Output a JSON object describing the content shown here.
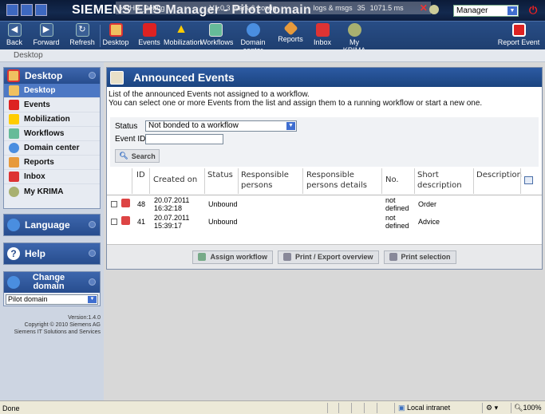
{
  "topbar": {
    "brand": "SIEMENS EHS Manager - Pilot domain",
    "debug_label": "» PHP_Debug",
    "version_tag": "V1.0.3",
    "vars_config": "vars & config",
    "logs_msgs": "logs & msgs",
    "query_count": "35",
    "timing": "1071.5 ms",
    "role_selected": "Manager"
  },
  "toolbar": {
    "back": "Back",
    "forward": "Forward",
    "refresh": "Refresh",
    "desktop": "Desktop",
    "events": "Events",
    "mobilization": "Mobilization",
    "workflows": "Workflows",
    "domain_center": "Domain center",
    "reports": "Reports",
    "inbox": "Inbox",
    "my_krima": "My KRIMA",
    "report_event": "Report Event"
  },
  "breadcrumb": "Desktop",
  "sidebar": {
    "desktop_panel": "Desktop",
    "items": [
      {
        "label": "Desktop"
      },
      {
        "label": "Events"
      },
      {
        "label": "Mobilization"
      },
      {
        "label": "Workflows"
      },
      {
        "label": "Domain center"
      },
      {
        "label": "Reports"
      },
      {
        "label": "Inbox"
      },
      {
        "label": "My KRIMA"
      }
    ],
    "language_panel": "Language",
    "help_panel": "Help",
    "change_domain_panel": "Change domain",
    "domain_selected": "Pilot domain",
    "version": "Version:1.4.0",
    "copyright": "Copyright © 2010 Siemens AG",
    "company": "Siemens IT Solutions and Services"
  },
  "main": {
    "title": "Announced Events",
    "desc1": "List of the announced Events not assigned to a workflow.",
    "desc2": "You can select one or more Events from the list and assign them to a running workflow or start a new one.",
    "filter": {
      "status_label": "Status",
      "status_value": "Not bonded to a workflow",
      "event_id_label": "Event ID",
      "search_button": "Search"
    },
    "table": {
      "headers": {
        "id": "ID",
        "created_on": "Created on",
        "status": "Status",
        "responsible_persons": "Responsible persons",
        "responsible_details": "Responsible persons details",
        "no": "No.",
        "short_description": "Short description",
        "description": "Description"
      },
      "rows": [
        {
          "id": "48",
          "date": "20.07.2011",
          "time": "16:32:18",
          "status": "Unbound",
          "no1": "not",
          "no2": "defined",
          "short": "Order"
        },
        {
          "id": "41",
          "date": "20.07.2011",
          "time": "15:39:17",
          "status": "Unbound",
          "no1": "not",
          "no2": "defined",
          "short": "Advice"
        }
      ]
    },
    "actions": {
      "assign": "Assign workflow",
      "print_export": "Print / Export overview",
      "print_selection": "Print selection"
    }
  },
  "statusbar": {
    "left": "Done",
    "zone": "Local intranet",
    "zoom": "100%"
  }
}
